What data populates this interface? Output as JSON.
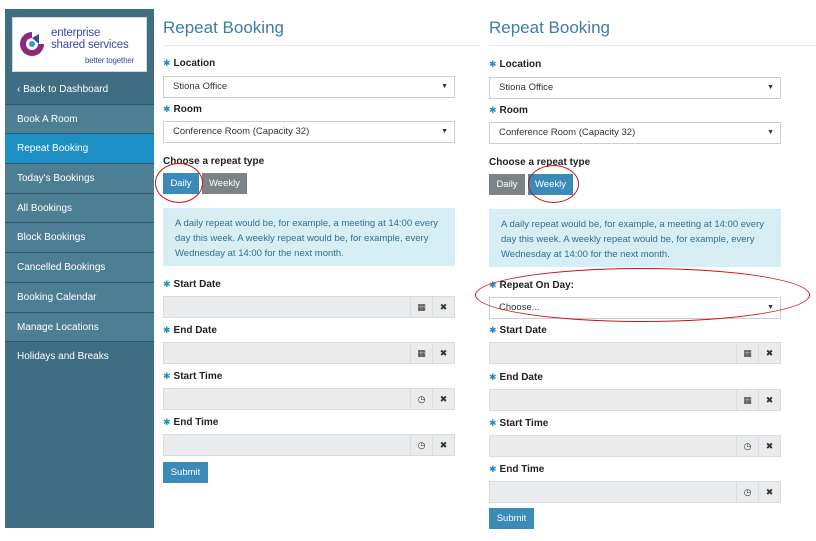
{
  "brand": {
    "line1": "enterprise",
    "line2": "shared services",
    "tagline": "better together",
    "color": "#3b4aa0"
  },
  "sidebar": {
    "items": [
      {
        "label": "‹  Back to Dashboard"
      },
      {
        "label": "Book A Room"
      },
      {
        "label": "Repeat Booking"
      },
      {
        "label": "Today's Bookings"
      },
      {
        "label": "All Bookings"
      },
      {
        "label": "Block Bookings"
      },
      {
        "label": "Cancelled Bookings"
      },
      {
        "label": "Booking Calendar"
      },
      {
        "label": "Manage Locations"
      },
      {
        "label": "Holidays and Breaks"
      }
    ],
    "active_item": "Repeat Booking"
  },
  "left": {
    "title": "Repeat Booking",
    "location_label": "Location",
    "location_value": "Stiona Office",
    "room_label": "Room",
    "room_value": "Conference Room (Capacity 32)",
    "repeat_type_label": "Choose a repeat type",
    "daily_label": "Daily",
    "weekly_label": "Weekly",
    "selected_type": "Daily",
    "info_text": "A daily repeat would be, for example, a meeting at 14:00 every day this week. A weekly repeat would be, for example, every Wednesday at 14:00 for the next month.",
    "start_date_label": "Start Date",
    "end_date_label": "End Date",
    "start_time_label": "Start Time",
    "end_time_label": "End Time",
    "submit_label": "Submit"
  },
  "right": {
    "title": "Repeat Booking",
    "location_label": "Location",
    "location_value": "Stiona Office",
    "room_label": "Room",
    "room_value": "Conference Room (Capacity 32)",
    "repeat_type_label": "Choose a repeat type",
    "daily_label": "Daily",
    "weekly_label": "Weekly",
    "selected_type": "Weekly",
    "info_text": "A daily repeat would be, for example, a meeting at 14:00 every day this week. A weekly repeat would be, for example, every Wednesday at 14:00 for the next month.",
    "repeat_day_label": "Repeat On Day:",
    "repeat_day_placeholder": "Choose...",
    "start_date_label": "Start Date",
    "end_date_label": "End Date",
    "start_time_label": "Start Time",
    "end_time_label": "End Time",
    "submit_label": "Submit"
  },
  "icons": {
    "required": "required-asterisk-icon",
    "calendar": "calendar-icon",
    "clock": "clock-icon",
    "clear": "clear-x-icon",
    "dropdown": "chevron-down-icon"
  },
  "colors": {
    "sidebar": "#3f6e82",
    "active": "#1d8fc4",
    "primary": "#3b8ab8",
    "info_bg": "#d6eef4",
    "annotation": "#d01010"
  }
}
